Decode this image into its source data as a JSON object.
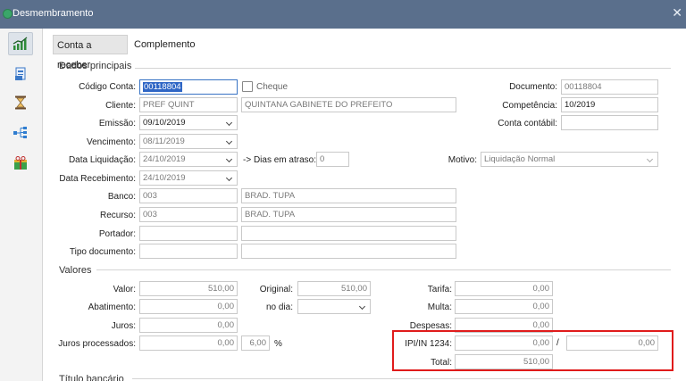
{
  "window": {
    "title": "Desmembramento",
    "close_glyph": "✕"
  },
  "sidebar": {
    "icons": [
      "chart-growth-icon",
      "document-icon",
      "hourglass-icon",
      "hierarchy-icon",
      "money-gift-icon"
    ]
  },
  "tabs": [
    {
      "label": "Conta a receber",
      "active": true
    },
    {
      "label": "Complemento",
      "active": false
    }
  ],
  "sections": {
    "dados_principais": "Dados principais",
    "valores": "Valores",
    "titulo_bancario": "Título bancário"
  },
  "dados": {
    "codigo_conta": {
      "label": "Código Conta:",
      "value": "00118804"
    },
    "cheque": {
      "label": "Cheque",
      "checked": false
    },
    "documento": {
      "label": "Documento:",
      "value": "00118804"
    },
    "cliente": {
      "label": "Cliente:",
      "value": "PREF QUINT",
      "name": "QUINTANA GABINETE DO PREFEITO"
    },
    "competencia": {
      "label": "Competência:",
      "value": "10/2019"
    },
    "emissao": {
      "label": "Emissão:",
      "value": "09/10/2019"
    },
    "conta_contabil": {
      "label": "Conta contábil:",
      "value": ""
    },
    "vencimento": {
      "label": "Vencimento:",
      "value": "08/11/2019"
    },
    "data_liquidacao": {
      "label": "Data Liquidação:",
      "value": "24/10/2019"
    },
    "dias_em_atraso": {
      "label": "-> Dias em atraso:",
      "value": "0"
    },
    "motivo": {
      "label": "Motivo:",
      "value": "Liquidação Normal"
    },
    "data_recebimento": {
      "label": "Data Recebimento:",
      "value": "24/10/2019"
    },
    "banco": {
      "label": "Banco:",
      "code": "003",
      "name": "BRAD. TUPA"
    },
    "recurso": {
      "label": "Recurso:",
      "code": "003",
      "name": "BRAD. TUPA"
    },
    "portador": {
      "label": "Portador:",
      "code": "",
      "name": ""
    },
    "tipo_documento": {
      "label": "Tipo documento:",
      "code": "",
      "name": ""
    }
  },
  "valores": {
    "valor": {
      "label": "Valor:",
      "value": "510,00"
    },
    "original": {
      "label": "Original:",
      "value": "510,00"
    },
    "tarifa": {
      "label": "Tarifa:",
      "value": "0,00"
    },
    "abatimento": {
      "label": "Abatimento:",
      "value": "0,00"
    },
    "no_dia": {
      "label": "no dia:",
      "value": ""
    },
    "multa": {
      "label": "Multa:",
      "value": "0,00"
    },
    "juros": {
      "label": "Juros:",
      "value": "0,00"
    },
    "despesas": {
      "label": "Despesas:",
      "value": "0,00"
    },
    "juros_processados": {
      "label": "Juros processados:",
      "value": "0,00",
      "rate": "6,00",
      "unit": "%"
    },
    "ipi_in_1234": {
      "label": "IPI/IN 1234:",
      "value_a": "0,00",
      "separator": "/",
      "value_b": "0,00"
    },
    "total": {
      "label": "Total:",
      "value": "510,00"
    }
  },
  "colors": {
    "titlebar": "#5a6f8c",
    "highlight_box": "#e01b1b",
    "selection": "#2f66c5"
  }
}
